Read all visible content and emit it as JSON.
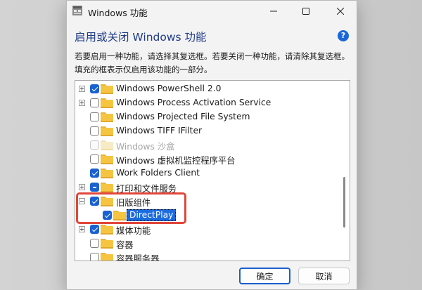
{
  "window": {
    "title": "Windows 功能",
    "heading": "启用或关闭 Windows 功能",
    "help_label": "?",
    "description": "若要启用一种功能，请选择其复选框。若要关闭一种功能，请清除其复选框。填充的框表示仅启用该功能的一部分。"
  },
  "features": [
    {
      "label": "Windows PowerShell 2.0",
      "checkbox": "checked",
      "expander": "plus"
    },
    {
      "label": "Windows Process Activation Service",
      "checkbox": "unchecked",
      "expander": "plus"
    },
    {
      "label": "Windows Projected File System",
      "checkbox": "unchecked",
      "expander": ""
    },
    {
      "label": "Windows TIFF IFilter",
      "checkbox": "unchecked",
      "expander": ""
    },
    {
      "label": "Windows 沙盒",
      "checkbox": "disabled",
      "expander": ""
    },
    {
      "label": "Windows 虚拟机监控程序平台",
      "checkbox": "unchecked",
      "expander": ""
    },
    {
      "label": "Work Folders Client",
      "checkbox": "checked",
      "expander": ""
    },
    {
      "label": "打印和文件服务",
      "checkbox": "partial",
      "expander": "plus"
    },
    {
      "label": "旧版组件",
      "checkbox": "checked",
      "expander": "minus"
    },
    {
      "label": "DirectPlay",
      "checkbox": "checked",
      "expander": "",
      "child": true,
      "selected": true
    },
    {
      "label": "媒体功能",
      "checkbox": "checked",
      "expander": "plus"
    },
    {
      "label": "容器",
      "checkbox": "unchecked",
      "expander": ""
    },
    {
      "label": "容器服务器",
      "checkbox": "unchecked",
      "expander": ""
    }
  ],
  "buttons": {
    "ok": "确定",
    "cancel": "取消"
  },
  "colors": {
    "heading": "#1f3b87",
    "accent": "#1961d0",
    "highlight": "#e0473a"
  }
}
